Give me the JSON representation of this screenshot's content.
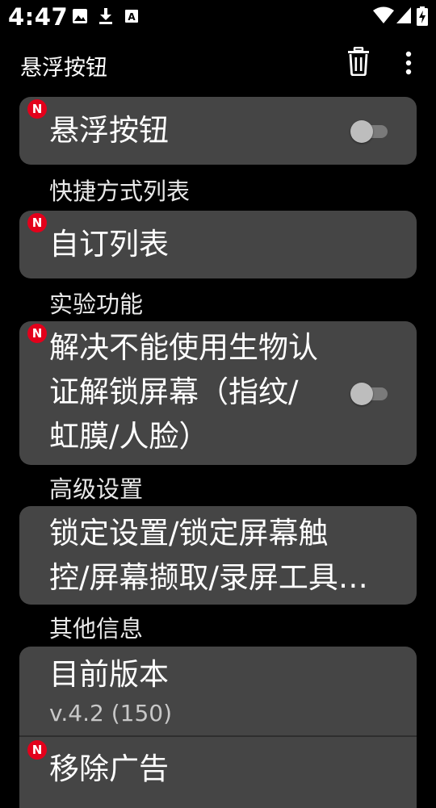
{
  "status_bar": {
    "time": "4:47",
    "icons": [
      "image-icon",
      "download-icon",
      "keyboard-a-icon"
    ],
    "right_icons": [
      "wifi-icon",
      "signal-icon",
      "battery-charging-icon"
    ]
  },
  "app_bar": {
    "title": "悬浮按钮",
    "actions": [
      "trash-icon",
      "more-vert-icon"
    ]
  },
  "cards": {
    "floating_button": {
      "label": "悬浮按钮",
      "badge": "N",
      "toggle_on": false
    },
    "custom_list": {
      "label": "自订列表",
      "badge": "N"
    },
    "biometric": {
      "lines": [
        "解决不能使用生物认",
        "证解锁屏幕（指纹/",
        "虹膜/人脸）"
      ],
      "badge": "N",
      "toggle_on": false
    },
    "advanced": {
      "lines": [
        "锁定设置/锁定屏幕触",
        "控/屏幕撷取/录屏工具…"
      ]
    },
    "version": {
      "label": "目前版本",
      "value": "v.4.2 (150)"
    },
    "remove_ads": {
      "label": "移除广告",
      "badge": "N"
    }
  },
  "sections": {
    "shortcut_list": "快捷方式列表",
    "experimental": "实验功能",
    "advanced_settings": "高级设置",
    "other_info": "其他信息"
  },
  "colors": {
    "background": "#000000",
    "card": "#454545",
    "badge": "#e3001b"
  }
}
